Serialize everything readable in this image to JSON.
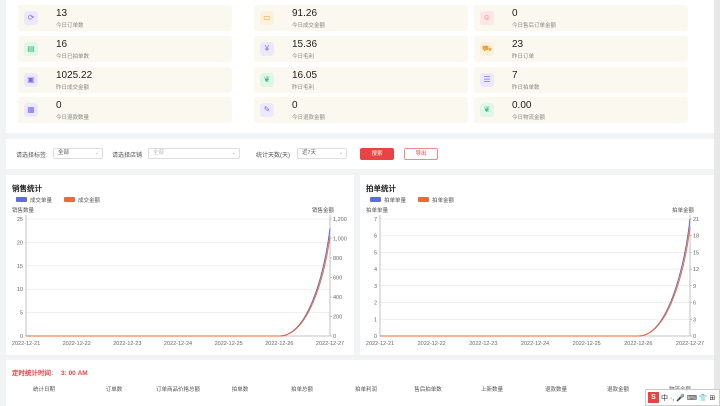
{
  "stats": [
    {
      "value": "13",
      "label": "今日订单数",
      "icon": "refresh-icon",
      "color": "#7b6cf6",
      "bg": "#ece9fe"
    },
    {
      "value": "91.26",
      "label": "今日成交金额",
      "icon": "wallet-icon",
      "color": "#e6a23c",
      "bg": "#fdf1dc"
    },
    {
      "value": "0",
      "label": "今日售后订单金额",
      "icon": "user-icon",
      "color": "#f56c6c",
      "bg": "#fde6e6"
    },
    {
      "value": "16",
      "label": "今日已拍单数",
      "icon": "bag-icon",
      "color": "#3fbf73",
      "bg": "#e0f6e8"
    },
    {
      "value": "15.36",
      "label": "今日毛利",
      "icon": "coin-icon",
      "color": "#7b6cf6",
      "bg": "#ece9fe"
    },
    {
      "value": "23",
      "label": "昨日订单",
      "icon": "cart-icon",
      "color": "#e6a23c",
      "bg": "#fdf1dc"
    },
    {
      "value": "1025.22",
      "label": "昨日成交金额",
      "icon": "money-icon",
      "color": "#7b6cf6",
      "bg": "#ece9fe"
    },
    {
      "value": "16.05",
      "label": "昨日毛利",
      "icon": "leaf-icon",
      "color": "#3fbf73",
      "bg": "#e0f6e8"
    },
    {
      "value": "7",
      "label": "昨日拍单数",
      "icon": "list-icon",
      "color": "#7b6cf6",
      "bg": "#ece9fe"
    },
    {
      "value": "0",
      "label": "今日退款数量",
      "icon": "doc-icon",
      "color": "#7b6cf6",
      "bg": "#ece9fe"
    },
    {
      "value": "0",
      "label": "今日退款金额",
      "icon": "edit-icon",
      "color": "#7b6cf6",
      "bg": "#ece9fe"
    },
    {
      "value": "0.00",
      "label": "今日物流金额",
      "icon": "leaf-icon",
      "color": "#3fbf73",
      "bg": "#e0f6e8"
    }
  ],
  "filter": {
    "tag_label": "请选择标签:",
    "tag_value": "全部",
    "shop_label": "请选择店铺",
    "shop_value": "全部",
    "days_label": "统计天数(天)",
    "days_value": "近7天",
    "search": "搜索",
    "export": "导出"
  },
  "chart_data": [
    {
      "type": "line",
      "title": "销售统计",
      "x": [
        "2022-12-21",
        "2022-12-22",
        "2022-12-23",
        "2022-12-24",
        "2022-12-25",
        "2022-12-26",
        "2022-12-27"
      ],
      "series": [
        {
          "name": "成交单量",
          "color": "#5b6ee1",
          "values": [
            0,
            0,
            0,
            0,
            0,
            0,
            23
          ],
          "axis": "left"
        },
        {
          "name": "成交金额",
          "color": "#ee6a2f",
          "values": [
            0,
            0,
            0,
            0,
            0,
            0,
            1025.22
          ],
          "axis": "right"
        }
      ],
      "ylabel_left": "销售数量",
      "ylabel_right": "销售金额",
      "ylim_left": [
        0,
        25
      ],
      "yticks_left": [
        "0",
        "5",
        "10",
        "15",
        "20",
        "25"
      ],
      "ylim_right": [
        0,
        1200
      ],
      "yticks_right": [
        "0",
        "200",
        "400",
        "600",
        "800",
        "1,000",
        "1,200"
      ],
      "legend": "top-left",
      "grid": true
    },
    {
      "type": "line",
      "title": "拍单统计",
      "x": [
        "2022-12-21",
        "2022-12-22",
        "2022-12-23",
        "2022-12-24",
        "2022-12-25",
        "2022-12-26",
        "2022-12-27"
      ],
      "series": [
        {
          "name": "拍单单量",
          "color": "#5b6ee1",
          "values": [
            0,
            0,
            0,
            0,
            0,
            0,
            7
          ],
          "axis": "left"
        },
        {
          "name": "拍单金额",
          "color": "#ee6a2f",
          "values": [
            0,
            0,
            0,
            0,
            0,
            0,
            19.5
          ],
          "axis": "right"
        }
      ],
      "ylabel_left": "拍单单量",
      "ylabel_right": "拍单金额",
      "ylim_left": [
        0,
        7
      ],
      "yticks_left": [
        "0",
        "1",
        "2",
        "3",
        "4",
        "5",
        "6",
        "7"
      ],
      "ylim_right": [
        0,
        21
      ],
      "yticks_right": [
        "0",
        "3",
        "6",
        "9",
        "12",
        "15",
        "18",
        "21"
      ],
      "legend": "top-left",
      "grid": true
    }
  ],
  "timer": {
    "label": "定时统计时间:",
    "value": "3: 00 AM"
  },
  "table_headers": [
    "统计日期",
    "订单数",
    "订单商品价格总额",
    "拍单数",
    "拍单总额",
    "拍单利润",
    "售后拍单数",
    "上新数量",
    "退款数量",
    "退款金额",
    "物流金额"
  ],
  "ime": {
    "logo": "S",
    "text": "中 ·, 🎤 ⌨ 👕 ⊞"
  }
}
